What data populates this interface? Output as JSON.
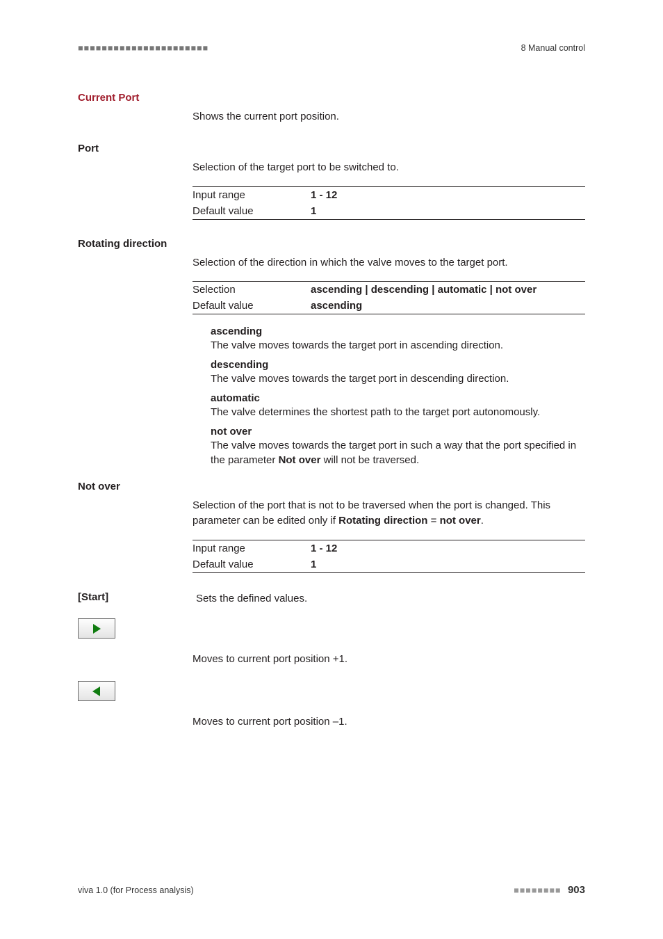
{
  "header": {
    "dashes": "■■■■■■■■■■■■■■■■■■■■■■",
    "right": "8 Manual control"
  },
  "currentPort": {
    "label": "Current Port",
    "desc": "Shows the current port position."
  },
  "port": {
    "label": "Port",
    "desc": "Selection of the target port to be switched to.",
    "rows": {
      "inputRangeK": "Input range",
      "inputRangeV": "1 - 12",
      "defaultK": "Default value",
      "defaultV": "1"
    }
  },
  "rotating": {
    "label": "Rotating direction",
    "desc": "Selection of the direction in which the valve moves to the target port.",
    "rows": {
      "selectionK": "Selection",
      "selectionV": "ascending | descending | automatic | not over",
      "defaultK": "Default value",
      "defaultV": "ascending"
    },
    "opts": {
      "ascLabel": "ascending",
      "ascText": "The valve moves towards the target port in ascending direction.",
      "descLabel": "descending",
      "descText": "The valve moves towards the target port in descending direction.",
      "autoLabel": "automatic",
      "autoText": "The valve determines the shortest path to the target port autonomously.",
      "noLabel": "not over",
      "noText1": "The valve moves towards the target port in such a way that the port specified in the parameter ",
      "noBold": "Not over",
      "noText2": " will not be traversed."
    }
  },
  "notOver": {
    "label": "Not over",
    "desc1": "Selection of the port that is not to be traversed when the port is changed. This parameter can be edited only if ",
    "b1": "Rotating direction",
    "eq": " = ",
    "b2": "not over",
    "period": ".",
    "rows": {
      "inputRangeK": "Input range",
      "inputRangeV": "1 - 12",
      "defaultK": "Default value",
      "defaultV": "1"
    }
  },
  "start": {
    "label": "[Start]",
    "desc": "Sets the defined values."
  },
  "fwd": {
    "desc": "Moves to current port position +1."
  },
  "back": {
    "desc": "Moves to current port position –1."
  },
  "footer": {
    "left": "viva 1.0 (for Process analysis)",
    "dashes": "■■■■■■■■",
    "page": "903"
  }
}
